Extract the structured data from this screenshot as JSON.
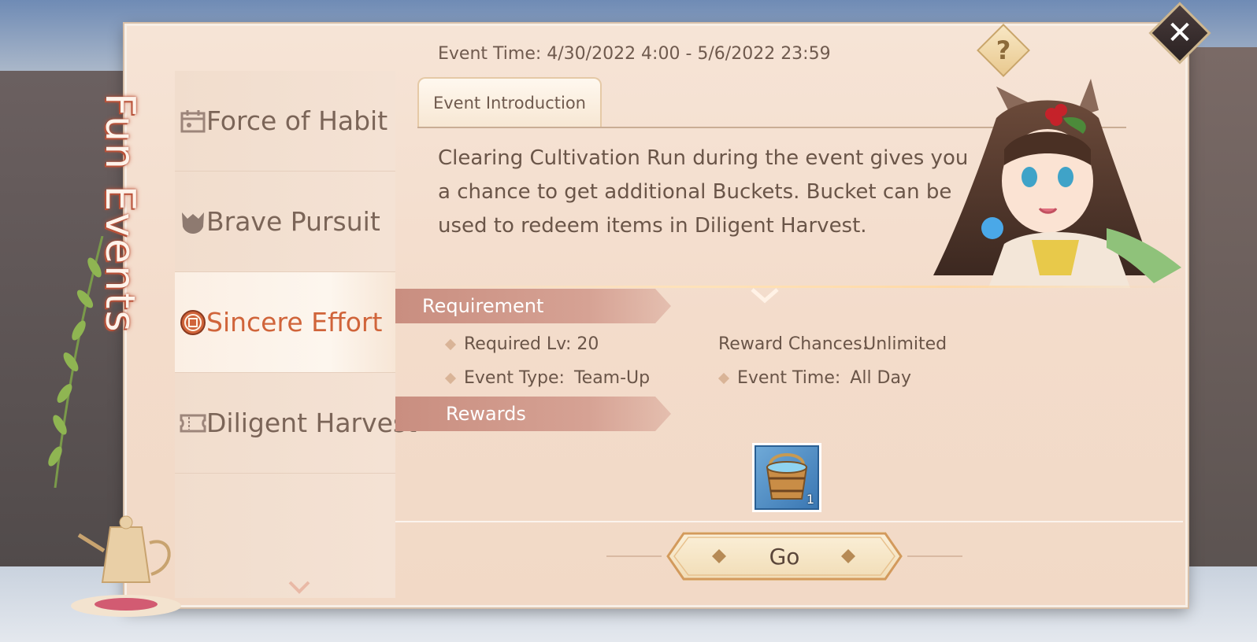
{
  "panel_title": "Fun Events",
  "header": {
    "event_time": "Event Time: 4/30/2022 4:00 - 5/6/2022 23:59",
    "help_label": "?"
  },
  "sidebar": {
    "items": [
      {
        "label": "Force of Habit",
        "icon": "calendar-icon",
        "active": false
      },
      {
        "label": "Brave Pursuit",
        "icon": "helmet-icon",
        "active": false
      },
      {
        "label": "Sincere Effort",
        "icon": "coin-icon",
        "active": true
      },
      {
        "label": "Diligent Harvest",
        "icon": "ticket-icon",
        "active": false
      }
    ]
  },
  "tab": {
    "label": "Event Introduction"
  },
  "intro": {
    "text": "Clearing Cultivation Run during the event gives you a chance to get additional Buckets. Bucket can be used to redeem items in Diligent Harvest."
  },
  "requirement": {
    "title": "Requirement",
    "required_lv": "Required Lv: 20",
    "reward_chances_label": "Reward Chances:",
    "reward_chances_value": "Unlimited",
    "event_type_label": "Event Type:",
    "event_type_value": "Team-Up",
    "event_time_label": "Event Time:",
    "event_time_value": "All Day"
  },
  "rewards": {
    "title": "Rewards",
    "items": [
      {
        "icon": "bucket-icon",
        "count": "1"
      }
    ]
  },
  "go_button": {
    "label": "Go"
  },
  "colors": {
    "panel_bg": "#f3dccb",
    "accent_active": "#d0643a",
    "section_header": "#c98e80",
    "text": "#6a5548"
  }
}
